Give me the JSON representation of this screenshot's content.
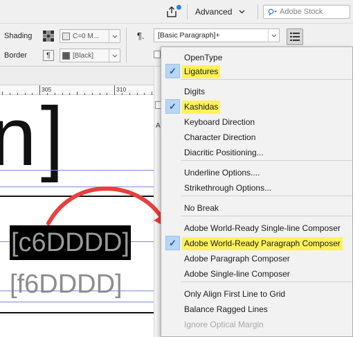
{
  "appbar": {
    "workspace_label": "Advanced",
    "search_placeholder": "Adobe Stock"
  },
  "control_panel": {
    "shading_label": "Shading",
    "border_label": "Border",
    "shading_color": "C=0 M...",
    "border_color": "[Black]",
    "paragraph_style": "[Basic Paragraph]+"
  },
  "ruler": {
    "marks": [
      "305",
      "310"
    ]
  },
  "document": {
    "large_text": "n]",
    "line1": "[c6DDDD]",
    "line2": "[f6DDDD]"
  },
  "menu": {
    "items": [
      {
        "label": "OpenType",
        "checked": false,
        "highlighted": false,
        "enabled": true
      },
      {
        "label": "Ligatures",
        "checked": true,
        "highlighted": true,
        "enabled": true
      },
      {
        "label": "Digits",
        "checked": false,
        "highlighted": false,
        "enabled": true
      },
      {
        "label": "Kashidas",
        "checked": true,
        "highlighted": true,
        "enabled": true
      },
      {
        "label": "Keyboard Direction",
        "checked": false,
        "highlighted": false,
        "enabled": true
      },
      {
        "label": "Character Direction",
        "checked": false,
        "highlighted": false,
        "enabled": true
      },
      {
        "label": "Diacritic Positioning...",
        "checked": false,
        "highlighted": false,
        "enabled": true
      },
      {
        "label": "Underline Options....",
        "checked": false,
        "highlighted": false,
        "enabled": true
      },
      {
        "label": "Strikethrough Options...",
        "checked": false,
        "highlighted": false,
        "enabled": true
      },
      {
        "label": "No Break",
        "checked": false,
        "highlighted": false,
        "enabled": true
      },
      {
        "label": "Adobe World-Ready Single-line Composer",
        "checked": false,
        "highlighted": false,
        "enabled": true
      },
      {
        "label": "Adobe World-Ready Paragraph Composer",
        "checked": true,
        "highlighted": true,
        "enabled": true
      },
      {
        "label": "Adobe Paragraph Composer",
        "checked": false,
        "highlighted": false,
        "enabled": true
      },
      {
        "label": "Adobe Single-line Composer",
        "checked": false,
        "highlighted": false,
        "enabled": true
      },
      {
        "label": "Only Align First Line to Grid",
        "checked": false,
        "highlighted": false,
        "enabled": true
      },
      {
        "label": "Balance Ragged Lines",
        "checked": false,
        "highlighted": false,
        "enabled": true
      },
      {
        "label": "Ignore Optical Margin",
        "checked": false,
        "highlighted": false,
        "enabled": false
      }
    ]
  },
  "colors": {
    "highlight": "#fff25a",
    "check_bg": "#b9d6f2",
    "arrow": "#e8403d",
    "guide": "#7f8ad6"
  }
}
